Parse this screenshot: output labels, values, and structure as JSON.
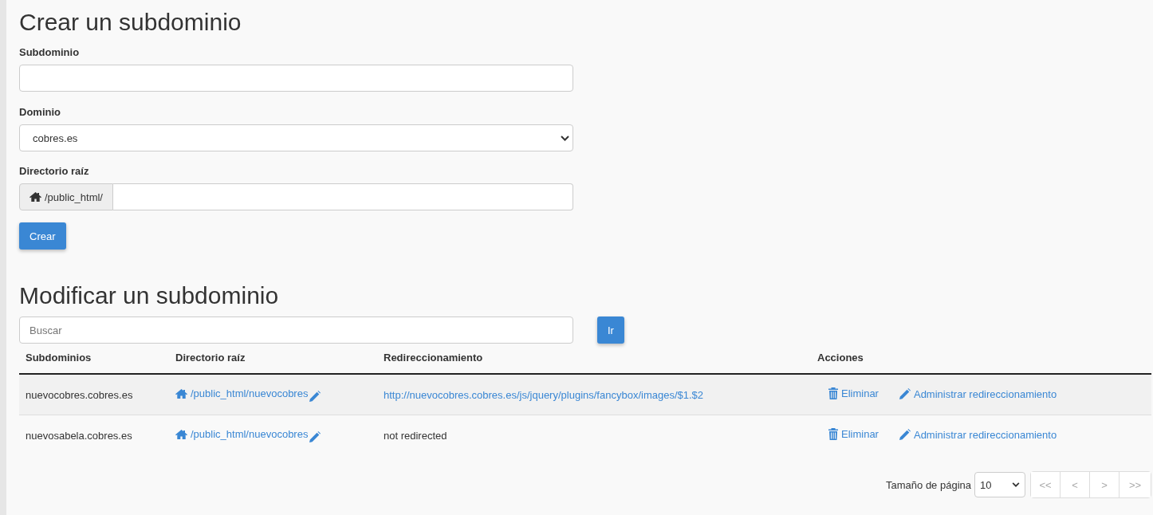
{
  "create": {
    "title": "Crear un subdominio",
    "subdomain": {
      "label": "Subdominio"
    },
    "domain": {
      "label": "Dominio",
      "value": "cobres.es"
    },
    "root": {
      "label": "Directorio raíz",
      "prefix": "/public_html/"
    },
    "button": "Crear"
  },
  "modify": {
    "title": "Modificar un subdominio",
    "search": {
      "placeholder": "Buscar"
    },
    "search_button": "Ir",
    "table": {
      "columns": [
        "Subdominios",
        "Directorio raíz",
        "Redireccionamiento",
        "Acciones"
      ],
      "rows": [
        {
          "subdomain": "nuevocobres.cobres.es",
          "root": "/public_html/nuevocobres",
          "redirect": "http://nuevocobres.cobres.es/js/jquery/plugins/fancybox/images/$1.$2",
          "redirected": true,
          "delete": "Eliminar",
          "manage": "Administrar redireccionamiento"
        },
        {
          "subdomain": "nuevosabela.cobres.es",
          "root": "/public_html/nuevocobres",
          "redirect": "not redirected",
          "redirected": false,
          "delete": "Eliminar",
          "manage": "Administrar redireccionamiento"
        }
      ]
    },
    "pagination": {
      "page_size_label": "Tamaño de página",
      "page_size": "10",
      "buttons": [
        {
          "label": "<<",
          "disabled": true
        },
        {
          "label": "<",
          "disabled": true
        },
        {
          "label": ">",
          "disabled": true
        },
        {
          "label": ">>",
          "disabled": true
        }
      ]
    }
  }
}
